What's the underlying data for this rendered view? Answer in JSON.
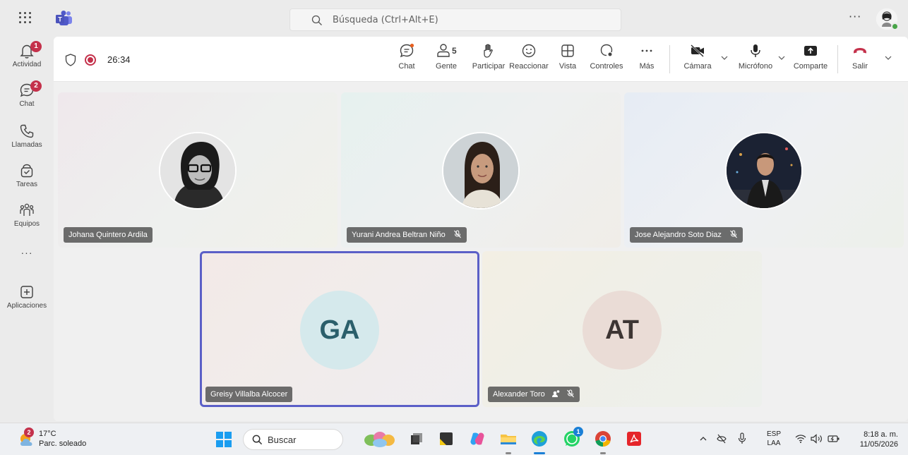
{
  "titlebar": {
    "search_placeholder": "Búsqueda (Ctrl+Alt+E)",
    "more_label": "···"
  },
  "rail": {
    "items": [
      {
        "label": "Actividad",
        "badge": "1"
      },
      {
        "label": "Chat",
        "badge": "2"
      },
      {
        "label": "Llamadas"
      },
      {
        "label": "Tareas"
      },
      {
        "label": "Equipos"
      },
      {
        "label": "···"
      },
      {
        "label": "Aplicaciones"
      }
    ]
  },
  "meeting": {
    "timer": "26:34",
    "controls": {
      "chat": "Chat",
      "people": "Gente",
      "people_count": "5",
      "raise": "Participar",
      "react": "Reaccionar",
      "view": "Vista",
      "controls": "Controles",
      "more": "Más",
      "camera": "Cámara",
      "mic": "Micrófono",
      "share": "Comparte",
      "leave": "Salir"
    },
    "participants": [
      {
        "name": "Johana Quintero Ardila",
        "muted": false
      },
      {
        "name": "Yurani Andrea Beltran Niño",
        "muted": true
      },
      {
        "name": "Jose Alejandro Soto Diaz",
        "muted": true
      },
      {
        "name": "Greisy Villalba Alcocer",
        "initials": "GA",
        "muted": false,
        "active_speaker": true
      },
      {
        "name": "Alexander Toro",
        "initials": "AT",
        "muted": true
      }
    ]
  },
  "taskbar": {
    "weather_badge": "2",
    "temperature": "17°C",
    "condition": "Parc. soleado",
    "search_label": "Buscar",
    "whatsapp_badge": "1",
    "lang_1": "ESP",
    "lang_2": "LAA",
    "time": "8:18 a. m.",
    "date": "11/05/2026"
  },
  "colors": {
    "accent": "#5b5fc7",
    "record": "#c4314b",
    "leave": "#c4314b",
    "badge": "#c4314b"
  }
}
